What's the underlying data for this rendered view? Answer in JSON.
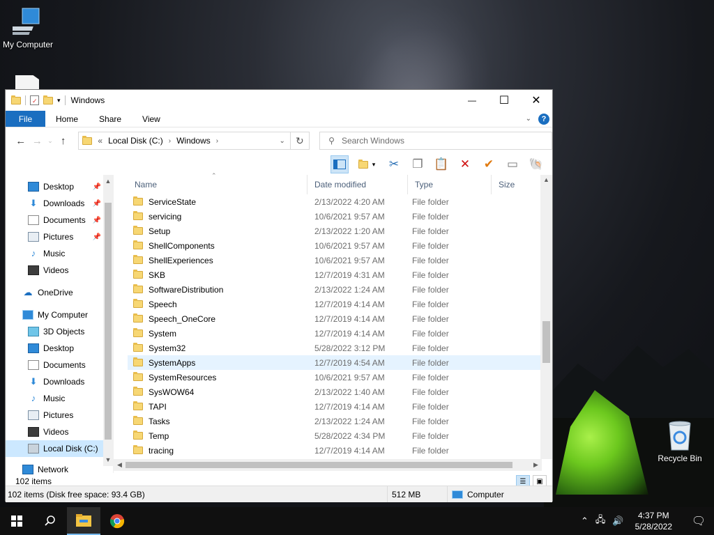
{
  "desktop": {
    "icons": [
      {
        "label": "My Computer"
      },
      {
        "label": "Recycle Bin"
      }
    ]
  },
  "window": {
    "title": "Windows",
    "caption": {
      "minimize": "—",
      "maximize": "☐",
      "close": "✕"
    }
  },
  "ribbon": {
    "tabs": [
      "File",
      "Home",
      "Share",
      "View"
    ],
    "help": "?"
  },
  "address": {
    "overflow": "«",
    "crumbs": [
      "Local Disk (C:)",
      "Windows"
    ],
    "search_placeholder": "Search Windows"
  },
  "nav": {
    "items": [
      {
        "label": "Desktop",
        "icon": "desktop-icon",
        "pinned": true
      },
      {
        "label": "Downloads",
        "icon": "downloads-icon",
        "pinned": true
      },
      {
        "label": "Documents",
        "icon": "documents-icon",
        "pinned": true
      },
      {
        "label": "Pictures",
        "icon": "pictures-icon",
        "pinned": true
      },
      {
        "label": "Music",
        "icon": "music-icon",
        "pinned": false
      },
      {
        "label": "Videos",
        "icon": "videos-icon",
        "pinned": false
      },
      {
        "label": "OneDrive",
        "icon": "onedrive-icon",
        "pinned": false
      },
      {
        "label": "My Computer",
        "icon": "computer-icon",
        "pinned": false
      },
      {
        "label": "3D Objects",
        "icon": "3d-objects-icon",
        "pinned": false
      },
      {
        "label": "Desktop",
        "icon": "desktop-icon",
        "pinned": false
      },
      {
        "label": "Documents",
        "icon": "documents-icon",
        "pinned": false
      },
      {
        "label": "Downloads",
        "icon": "downloads-icon",
        "pinned": false
      },
      {
        "label": "Music",
        "icon": "music-icon",
        "pinned": false
      },
      {
        "label": "Pictures",
        "icon": "pictures-icon",
        "pinned": false
      },
      {
        "label": "Videos",
        "icon": "videos-icon",
        "pinned": false
      },
      {
        "label": "Local Disk (C:)",
        "icon": "drive-icon",
        "pinned": false,
        "selected": true
      },
      {
        "label": "Network",
        "icon": "network-icon",
        "pinned": false
      }
    ]
  },
  "columns": [
    "Name",
    "Date modified",
    "Type",
    "Size"
  ],
  "files": [
    {
      "name": "ServiceState",
      "date": "2/13/2022 4:20 AM",
      "type": "File folder"
    },
    {
      "name": "servicing",
      "date": "10/6/2021 9:57 AM",
      "type": "File folder"
    },
    {
      "name": "Setup",
      "date": "2/13/2022 1:20 AM",
      "type": "File folder"
    },
    {
      "name": "ShellComponents",
      "date": "10/6/2021 9:57 AM",
      "type": "File folder"
    },
    {
      "name": "ShellExperiences",
      "date": "10/6/2021 9:57 AM",
      "type": "File folder"
    },
    {
      "name": "SKB",
      "date": "12/7/2019 4:31 AM",
      "type": "File folder"
    },
    {
      "name": "SoftwareDistribution",
      "date": "2/13/2022 1:24 AM",
      "type": "File folder"
    },
    {
      "name": "Speech",
      "date": "12/7/2019 4:14 AM",
      "type": "File folder"
    },
    {
      "name": "Speech_OneCore",
      "date": "12/7/2019 4:14 AM",
      "type": "File folder"
    },
    {
      "name": "System",
      "date": "12/7/2019 4:14 AM",
      "type": "File folder"
    },
    {
      "name": "System32",
      "date": "5/28/2022 3:12 PM",
      "type": "File folder"
    },
    {
      "name": "SystemApps",
      "date": "12/7/2019 4:54 AM",
      "type": "File folder",
      "hover": true
    },
    {
      "name": "SystemResources",
      "date": "10/6/2021 9:57 AM",
      "type": "File folder"
    },
    {
      "name": "SysWOW64",
      "date": "2/13/2022 1:40 AM",
      "type": "File folder"
    },
    {
      "name": "TAPI",
      "date": "12/7/2019 4:14 AM",
      "type": "File folder"
    },
    {
      "name": "Tasks",
      "date": "2/13/2022 1:24 AM",
      "type": "File folder"
    },
    {
      "name": "Temp",
      "date": "5/28/2022 4:34 PM",
      "type": "File folder"
    },
    {
      "name": "tracing",
      "date": "12/7/2019 4:14 AM",
      "type": "File folder"
    }
  ],
  "status": {
    "count": "102 items",
    "details": "102 items (Disk free space: 93.4 GB)",
    "size": "512 MB",
    "location": "Computer"
  },
  "taskbar": {
    "time": "4:37 PM",
    "date": "5/28/2022"
  },
  "colors": {
    "accent": "#1a6ec0",
    "folder": "#f7d774",
    "selection": "#cce8ff"
  }
}
